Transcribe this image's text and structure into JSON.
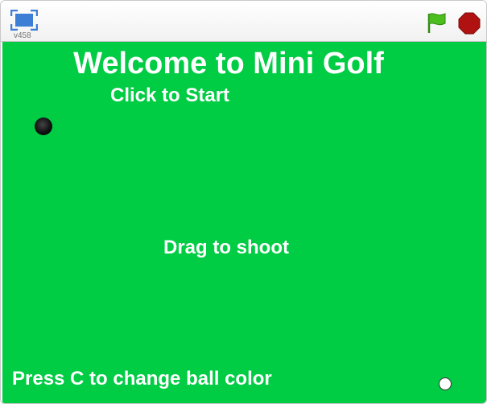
{
  "toolbar": {
    "version": "v458",
    "fullscreen_icon": "fullscreen-icon",
    "green_flag_icon": "green-flag-icon",
    "stop_icon": "stop-sign-icon"
  },
  "stage": {
    "title": "Welcome to Mini Golf",
    "start_text": "Click to Start",
    "drag_text": "Drag to shoot",
    "press_text": "Press C to change ball color"
  },
  "colors": {
    "stage_bg": "#00cc44",
    "text": "#ffffff",
    "flag": "#4cbf1f",
    "stop": "#b01212",
    "fullscreen": "#3d7fd4"
  }
}
